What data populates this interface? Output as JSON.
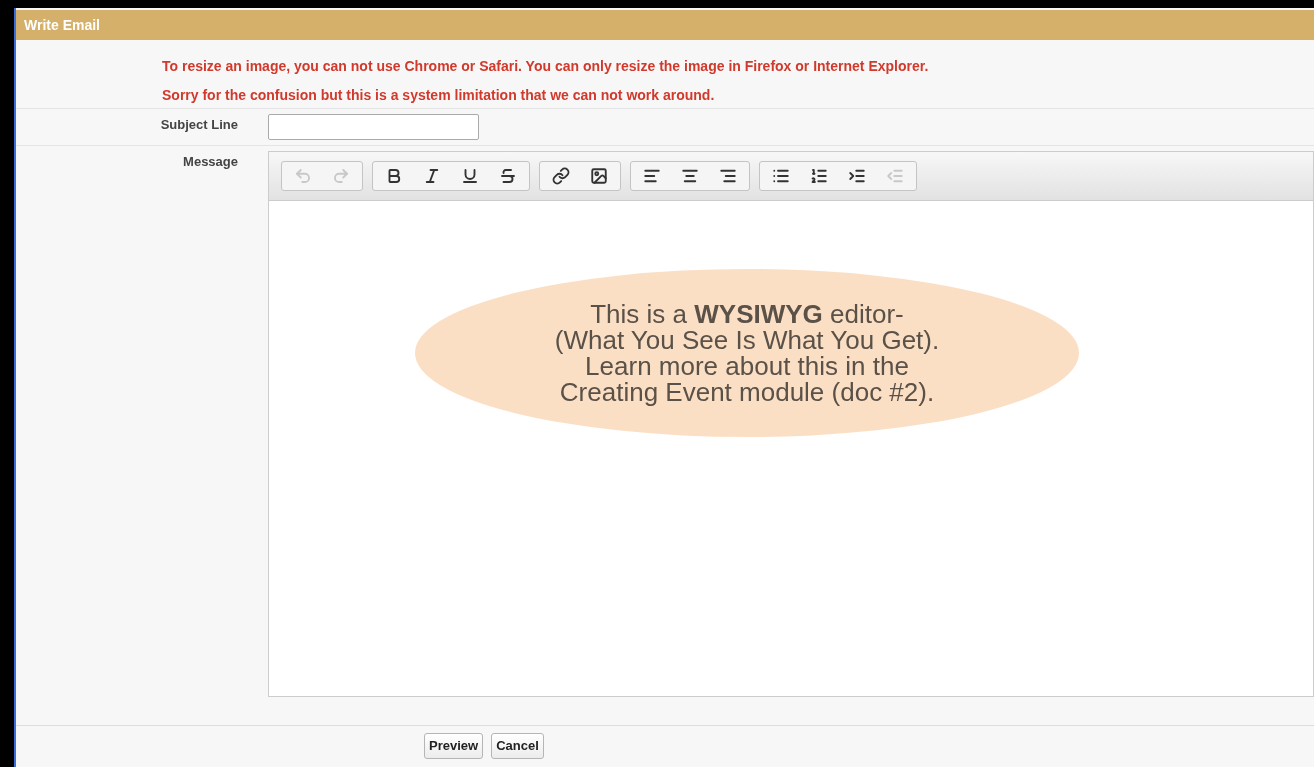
{
  "panel": {
    "title": "Write Email"
  },
  "notices": [
    "To resize an image, you can not use Chrome or Safari. You can only resize the image in Firefox or Internet Explorer.",
    "Sorry for the confusion but this is a system limitation that we can not work around."
  ],
  "subject": {
    "label": "Subject Line"
  },
  "message": {
    "label": "Message",
    "toolbar": [
      [
        {
          "kind": "undo",
          "disabled": true
        },
        {
          "kind": "redo",
          "disabled": true
        }
      ],
      [
        {
          "kind": "bold",
          "disabled": false
        },
        {
          "kind": "italic",
          "disabled": false
        },
        {
          "kind": "underline",
          "disabled": false
        },
        {
          "kind": "strikethrough",
          "disabled": false
        }
      ],
      [
        {
          "kind": "link",
          "disabled": false
        },
        {
          "kind": "image",
          "disabled": false
        }
      ],
      [
        {
          "kind": "align-left",
          "disabled": false
        },
        {
          "kind": "align-center",
          "disabled": false
        },
        {
          "kind": "align-right",
          "disabled": false
        }
      ],
      [
        {
          "kind": "bullet-list",
          "disabled": false
        },
        {
          "kind": "numbered-list",
          "disabled": false
        },
        {
          "kind": "indent",
          "disabled": false
        },
        {
          "kind": "outdent",
          "disabled": true
        }
      ]
    ]
  },
  "callout": {
    "lines": [
      "This is a **WYSIWYG** editor-",
      "(What You See Is What You Get).",
      "Learn more about this in the",
      "Creating Event module (doc #2)."
    ]
  },
  "buttons": [
    "Preview",
    "Cancel"
  ]
}
